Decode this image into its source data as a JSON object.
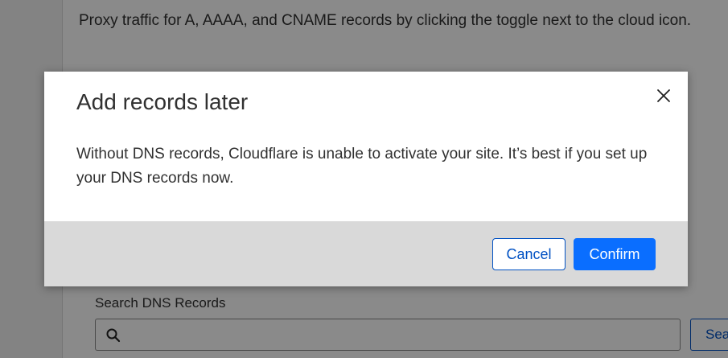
{
  "background": {
    "intro_text": "Proxy traffic for A, AAAA, and CNAME records by clicking the toggle next to the cloud icon.",
    "search_label": "Search DNS Records",
    "search_placeholder": "",
    "search_button_label": "Search"
  },
  "modal": {
    "title": "Add records later",
    "body": "Without DNS records, Cloudflare is unable to activate your site. It’s best if you set up your DNS records now.",
    "cancel_label": "Cancel",
    "confirm_label": "Confirm"
  },
  "icons": {
    "close": "close-icon",
    "search": "search-icon"
  },
  "colors": {
    "primary": "#0a6eff",
    "link": "#0051c3",
    "overlay": "rgba(0,0,0,0.46)",
    "footer": "#d9d9d9"
  }
}
